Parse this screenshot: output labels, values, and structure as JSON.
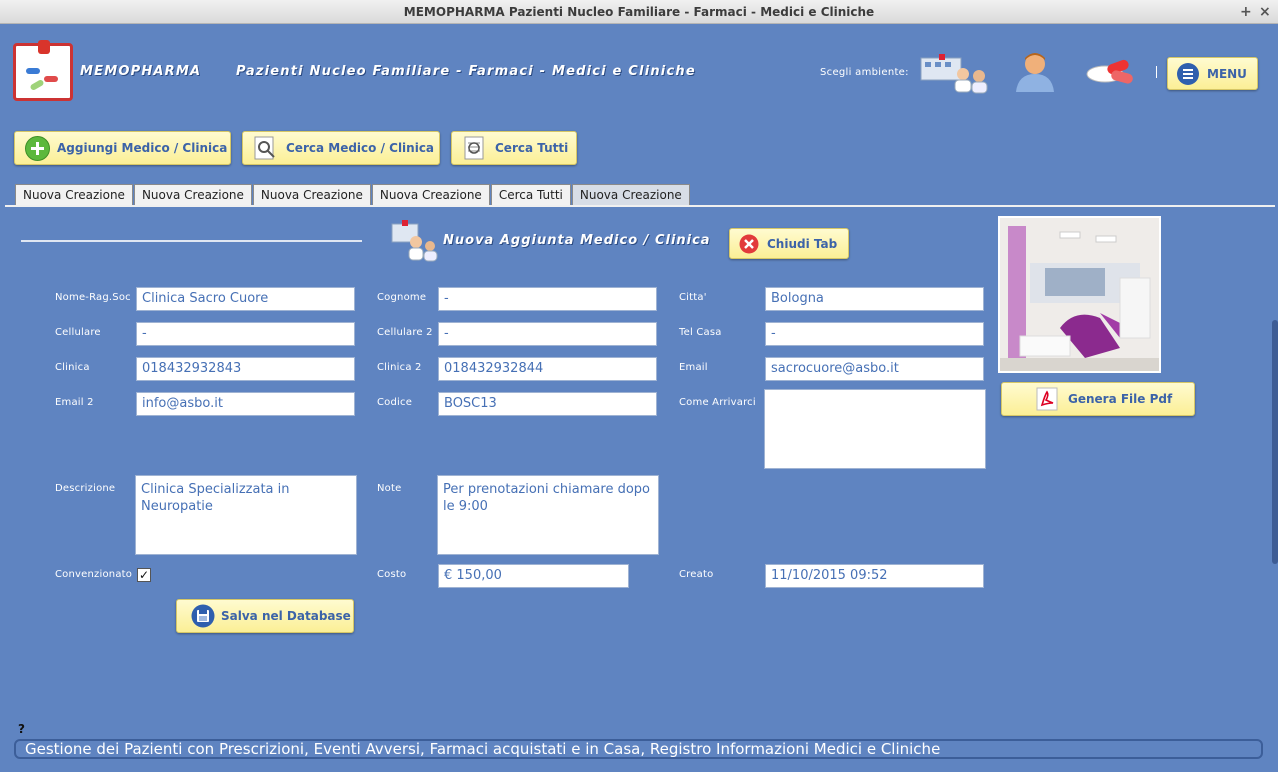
{
  "window": {
    "title": "MEMOPHARMA    Pazienti Nucleo Familiare - Farmaci - Medici e Cliniche",
    "maximize_glyph": "+",
    "close_glyph": "×"
  },
  "header": {
    "app_name": "MEMOPHARMA",
    "subtitle": "Pazienti Nucleo Familiare - Farmaci - Medici e Cliniche",
    "env_label": "Scegli ambiente:",
    "separator": "|",
    "menu_label": "MENU",
    "env_icons": [
      "doctors-clinic-icon",
      "patient-icon",
      "pills-icon"
    ]
  },
  "toolbar": {
    "add_label": "Aggiungi Medico / Clinica",
    "search_label": "Cerca Medico / Clinica",
    "search_all_label": "Cerca Tutti"
  },
  "tabs": [
    {
      "label": "Nuova Creazione",
      "active": false
    },
    {
      "label": "Nuova Creazione",
      "active": false
    },
    {
      "label": "Nuova Creazione",
      "active": false
    },
    {
      "label": "Nuova Creazione",
      "active": false
    },
    {
      "label": "Cerca Tutti",
      "active": false
    },
    {
      "label": "Nuova Creazione",
      "active": true
    }
  ],
  "form": {
    "title": "Nuova Aggiunta Medico / Clinica",
    "close_tab_label": "Chiudi Tab",
    "generate_pdf_label": "Genera File Pdf",
    "save_label": "Salva nel Database",
    "labels": {
      "nome": "Nome-Rag.Soc",
      "cognome": "Cognome",
      "citta": "Citta'",
      "cellulare": "Cellulare",
      "cellulare2": "Cellulare 2",
      "tel_casa": "Tel Casa",
      "clinica": "Clinica",
      "clinica2": "Clinica 2",
      "email": "Email",
      "email2": "Email 2",
      "codice": "Codice",
      "come_arrivarci": "Come Arrivarci",
      "descrizione": "Descrizione",
      "note": "Note",
      "convenzionato": "Convenzionato",
      "costo": "Costo",
      "creato": "Creato"
    },
    "values": {
      "nome": "Clinica Sacro Cuore",
      "cognome": "-",
      "citta": "Bologna",
      "cellulare": "-",
      "cellulare2": "-",
      "tel_casa": "-",
      "clinica": "018432932843",
      "clinica2": "018432932844",
      "email": "sacrocuore@asbo.it",
      "email2": "info@asbo.it",
      "codice": "BOSC13",
      "come_arrivarci": "",
      "descrizione": "Clinica Specializzata in Neuropatie",
      "note": "Per prenotazioni chiamare dopo le 9:00",
      "convenzionato_mark": "✓",
      "costo": "€ 150,00",
      "creato": "11/10/2015 09:52"
    }
  },
  "status": {
    "help_mark": "?",
    "text": "Gestione dei Pazienti con Prescrizioni, Eventi Avversi, Farmaci acquistati e in Casa, Registro Informazioni Medici e Cliniche"
  },
  "colors": {
    "background": "#5f84c1",
    "button_yellow": "#fbef96",
    "field_text": "#4670b5"
  }
}
